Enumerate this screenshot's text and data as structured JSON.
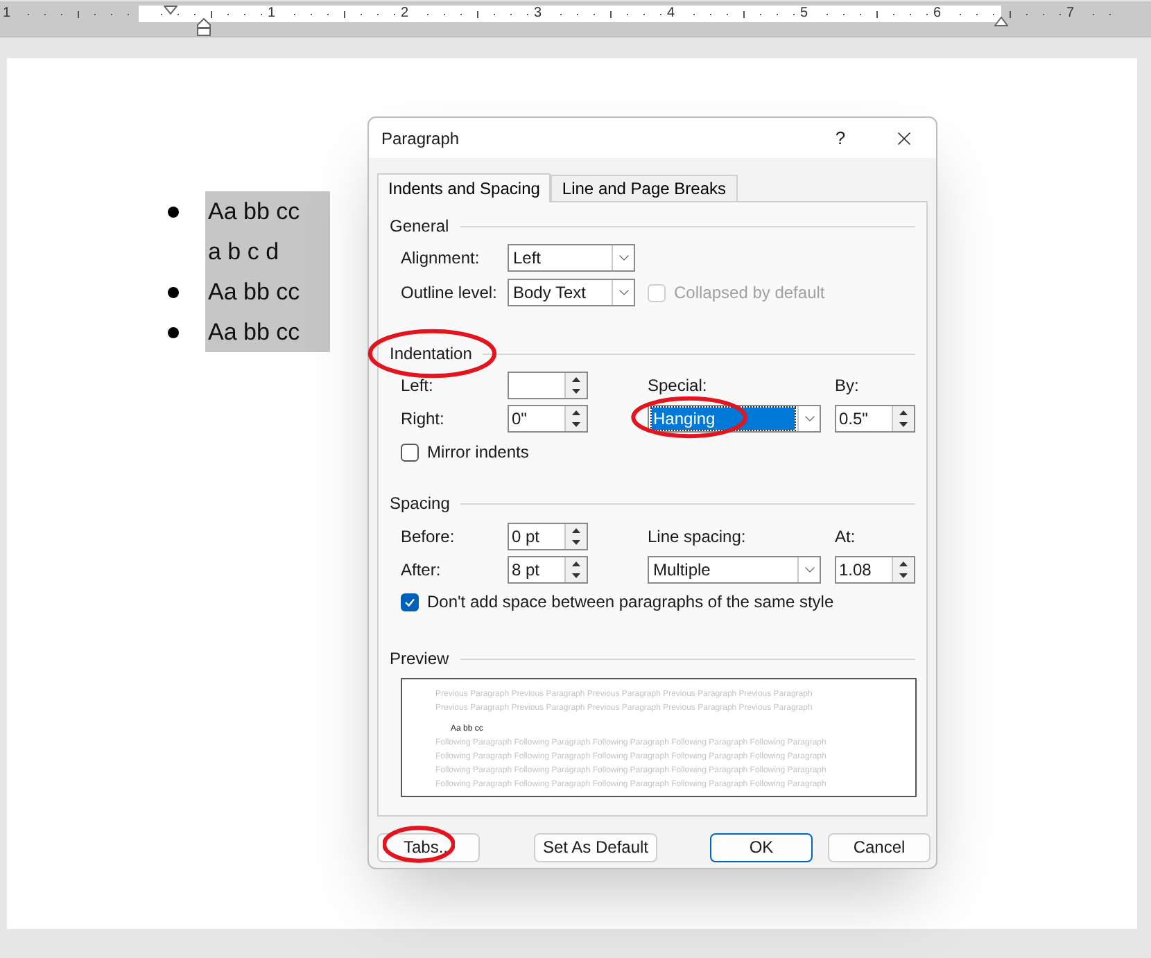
{
  "ruler": {
    "labels": [
      "1",
      "1",
      "2",
      "3",
      "4",
      "5",
      "6",
      "7"
    ]
  },
  "document": {
    "bullets": [
      {
        "lines": [
          "Aa bb cc",
          "a b c d"
        ]
      },
      {
        "lines": [
          "Aa bb cc"
        ]
      },
      {
        "lines": [
          "Aa bb cc"
        ]
      }
    ]
  },
  "dialog": {
    "title": "Paragraph",
    "help": "?",
    "tabs": [
      {
        "label": "Indents and Spacing",
        "selected": true
      },
      {
        "label": "Line and Page Breaks",
        "selected": false
      }
    ],
    "general": {
      "heading": "General",
      "alignment": {
        "label": "Alignment:",
        "value": "Left"
      },
      "outline_level": {
        "label": "Outline level:",
        "value": "Body Text"
      },
      "collapsed": {
        "label": "Collapsed by default",
        "checked": false,
        "disabled": true
      }
    },
    "indentation": {
      "heading": "Indentation",
      "circled": true,
      "left": {
        "label": "Left:"
      },
      "right": {
        "label": "Right:",
        "value": "0\""
      },
      "special": {
        "label": "Special:",
        "value": "Hanging",
        "selected": true,
        "circled": true
      },
      "by": {
        "label": "By:",
        "value": "0.5\""
      },
      "mirror": {
        "label": "Mirror indents",
        "checked": false
      }
    },
    "spacing": {
      "heading": "Spacing",
      "before": {
        "label": "Before:",
        "value": "0 pt"
      },
      "after": {
        "label": "After:",
        "value": "8 pt"
      },
      "line_spacing": {
        "label": "Line spacing:",
        "value": "Multiple"
      },
      "at": {
        "label": "At:",
        "value": "1.08"
      },
      "dont_add": {
        "label": "Don't add space between paragraphs of the same style",
        "checked": true
      }
    },
    "preview": {
      "heading": "Preview",
      "previous": [
        "Previous Paragraph Previous Paragraph Previous Paragraph Previous Paragraph Previous Paragraph",
        "Previous Paragraph Previous Paragraph Previous Paragraph Previous Paragraph Previous Paragraph"
      ],
      "sample": "Aa bb cc",
      "following": [
        "Following Paragraph Following Paragraph Following Paragraph Following Paragraph Following Paragraph",
        "Following Paragraph Following Paragraph Following Paragraph Following Paragraph Following Paragraph",
        "Following Paragraph Following Paragraph Following Paragraph Following Paragraph Following Paragraph",
        "Following Paragraph Following Paragraph Following Paragraph Following Paragraph Following Paragraph"
      ]
    },
    "buttons": [
      {
        "label": "Tabs..",
        "default": false,
        "circled": true
      },
      {
        "label": "Set As Default",
        "default": false,
        "circled": false
      },
      {
        "label": "OK",
        "default": true,
        "circled": false
      },
      {
        "label": "Cancel",
        "default": false,
        "circled": false
      }
    ]
  }
}
